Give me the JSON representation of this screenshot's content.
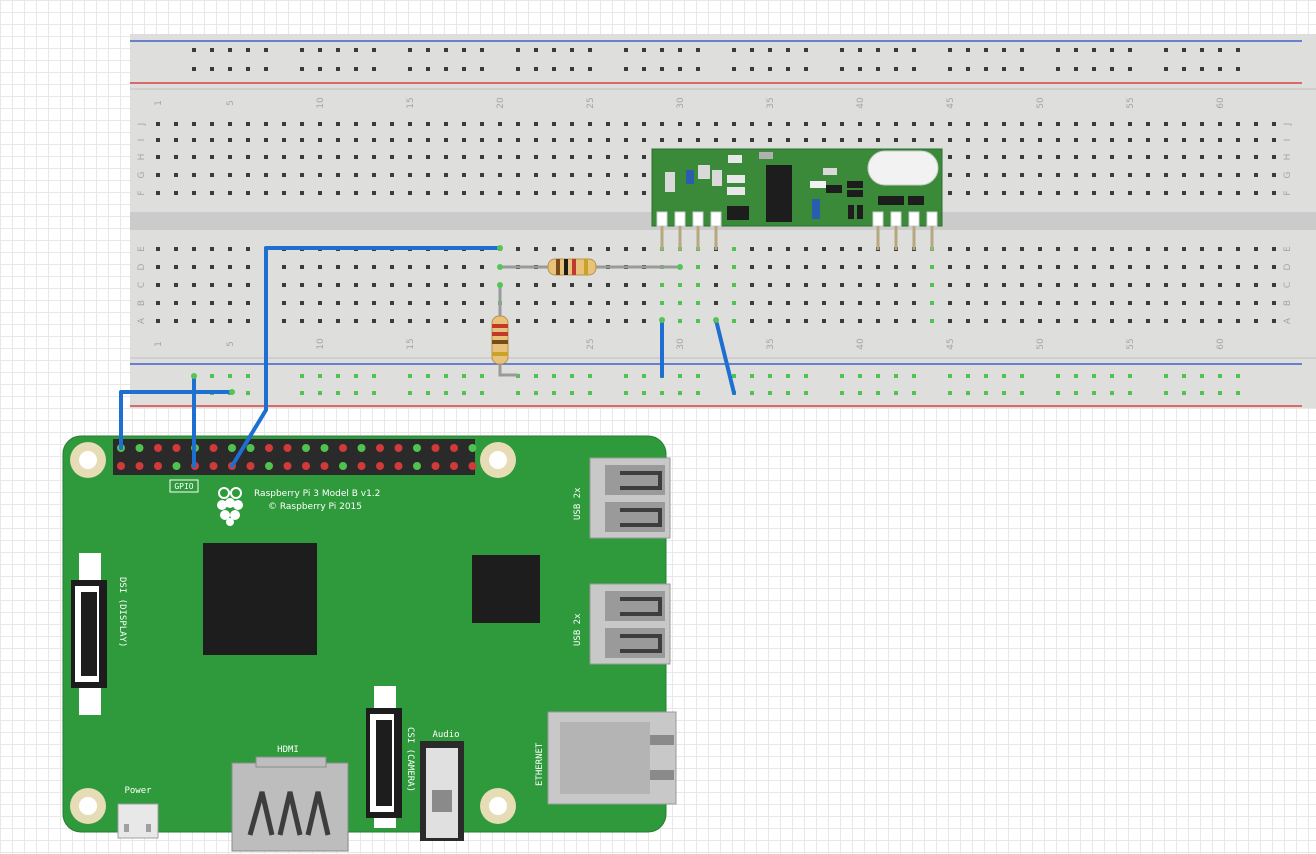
{
  "board": {
    "title": "Raspberry Pi 3 Model B v1.2",
    "copyright": "© Raspberry Pi 2015",
    "gpio_label": "GPIO",
    "dsi_label": "DSI (DISPLAY)",
    "csi_label": "CSI (CAMERA)",
    "hdmi_label": "HDMI",
    "audio_label": "Audio",
    "power_label": "Power",
    "usb1_label": "USB 2x",
    "usb2_label": "USB 2x",
    "ethernet_label": "ETHERNET"
  },
  "breadboard": {
    "column_numbers": [
      "1",
      "5",
      "10",
      "15",
      "20",
      "25",
      "30",
      "35",
      "40",
      "45",
      "50",
      "55",
      "60"
    ],
    "top_row_letters": [
      "J",
      "I",
      "H",
      "G",
      "F"
    ],
    "bottom_row_letters": [
      "E",
      "D",
      "C",
      "B",
      "A"
    ]
  },
  "colors": {
    "pcb": "#2e9a3b",
    "wire": "#1f6fd1",
    "breadboard": "#dededd",
    "module": "#3a8a3a",
    "rail_red": "#d64545",
    "rail_blue": "#4060c8"
  },
  "icons": {
    "logo": "raspberry-logo-icon"
  }
}
